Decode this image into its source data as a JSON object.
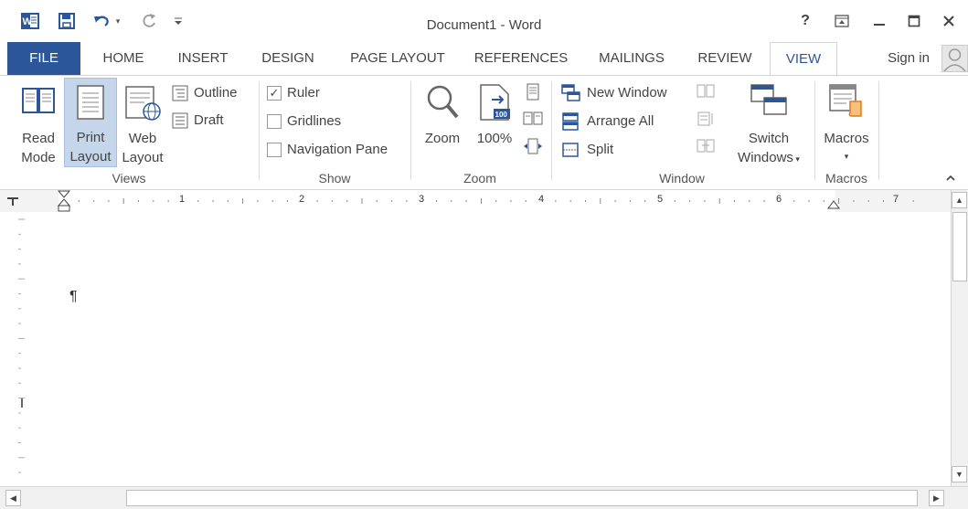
{
  "title_bar": {
    "title": "Document1 - Word",
    "help": "?",
    "icons": [
      "word-app-icon",
      "save-icon",
      "undo-icon",
      "redo-icon",
      "customize-qat-icon",
      "ribbon-display-options-icon",
      "minimize-icon",
      "maximize-icon",
      "close-icon"
    ]
  },
  "tabs": {
    "file": "FILE",
    "home": "HOME",
    "insert": "INSERT",
    "design": "DESIGN",
    "page_layout": "PAGE LAYOUT",
    "references": "REFERENCES",
    "mailings": "MAILINGS",
    "review": "REVIEW",
    "view": "VIEW",
    "sign_in": "Sign in"
  },
  "ribbon": {
    "views": {
      "label": "Views",
      "read_mode": [
        "Read",
        "Mode"
      ],
      "print_layout": [
        "Print",
        "Layout"
      ],
      "web_layout": [
        "Web",
        "Layout"
      ],
      "outline": "Outline",
      "draft": "Draft"
    },
    "show": {
      "label": "Show",
      "ruler": "Ruler",
      "ruler_checked": true,
      "gridlines": "Gridlines",
      "gridlines_checked": false,
      "navigation_pane": "Navigation Pane",
      "navigation_checked": false
    },
    "zoom": {
      "label": "Zoom",
      "zoom_button": "Zoom",
      "hundred": "100%",
      "hundred_icon_text": "100"
    },
    "window": {
      "label": "Window",
      "new_window": "New Window",
      "arrange_all": "Arrange All",
      "split": "Split",
      "switch_windows": [
        "Switch",
        "Windows"
      ]
    },
    "macros": {
      "label": "Macros",
      "macros_button": "Macros"
    }
  },
  "ruler": {
    "numbers": [
      "1",
      "2",
      "3",
      "4",
      "5",
      "6",
      "7"
    ]
  },
  "document": {
    "paragraph_mark": "¶"
  },
  "colors": {
    "accent": "#2b579a",
    "selected_button": "#c5d5ea"
  }
}
